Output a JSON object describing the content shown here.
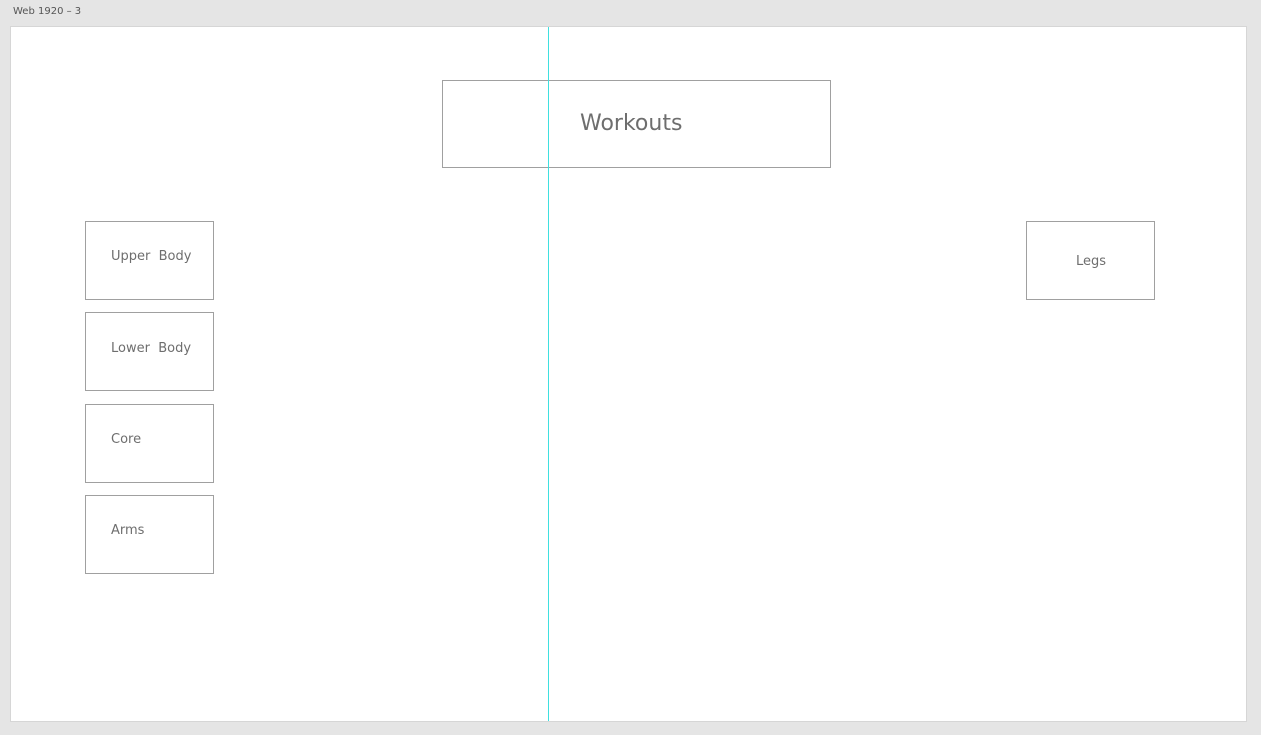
{
  "artboard": {
    "label": "Web 1920 – 3"
  },
  "title": {
    "label": "Workouts"
  },
  "categories": [
    {
      "label": "Upper  Body"
    },
    {
      "label": "Lower  Body"
    },
    {
      "label": "Core"
    },
    {
      "label": "Arms"
    }
  ],
  "detail": {
    "label": "Legs"
  },
  "colors": {
    "canvas_background": "#e5e5e5",
    "artboard_background": "#ffffff",
    "box_border": "#a0a0a0",
    "text": "#6e6e6e",
    "guide": "#3fe0e0"
  }
}
